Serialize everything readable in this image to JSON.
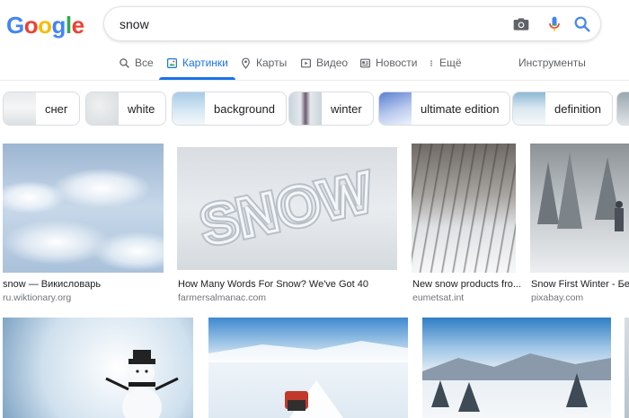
{
  "logo": {
    "letters": [
      "G",
      "o",
      "o",
      "g",
      "l",
      "e"
    ],
    "colors": [
      "#4285f4",
      "#ea4335",
      "#fbbc05",
      "#4285f4",
      "#34a853",
      "#ea4335"
    ]
  },
  "search": {
    "query": "snow"
  },
  "tabs": [
    {
      "label": "Все",
      "icon": "search-icon"
    },
    {
      "label": "Картинки",
      "icon": "image-icon"
    },
    {
      "label": "Карты",
      "icon": "map-pin-icon"
    },
    {
      "label": "Видео",
      "icon": "video-icon"
    },
    {
      "label": "Новости",
      "icon": "news-icon"
    },
    {
      "label": "Ещё",
      "icon": "more-vert-icon"
    }
  ],
  "tools_label": "Инструменты",
  "chips": [
    "снег",
    "white",
    "background",
    "winter",
    "ultimate edition",
    "definition"
  ],
  "results": [
    {
      "title": "snow — Викисловарь",
      "site": "ru.wiktionary.org"
    },
    {
      "title": "How Many Words For Snow? We've Got 40",
      "site": "farmersalmanac.com"
    },
    {
      "title": "New snow products fro...",
      "site": "eumetsat.int"
    },
    {
      "title": "Snow First Winter - Бесп",
      "site": "pixabay.com"
    }
  ],
  "colors": {
    "accent": "#1a73e8",
    "muted": "#70757a"
  }
}
